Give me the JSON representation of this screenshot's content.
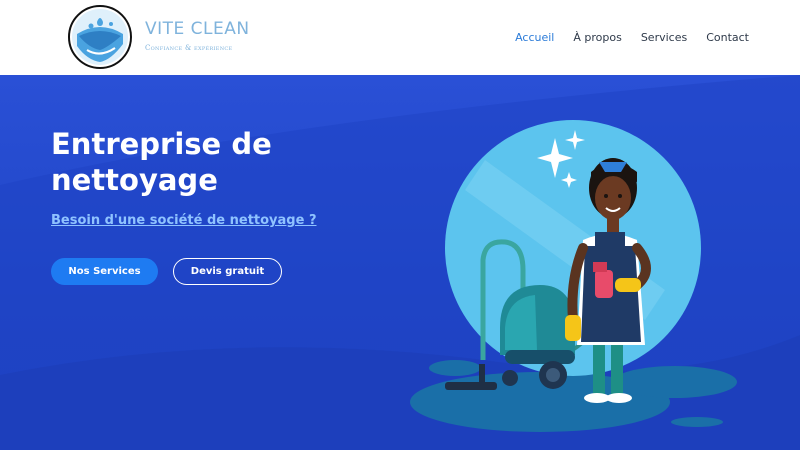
{
  "brand": {
    "name": "VITE CLEAN",
    "tagline": "Confiance & expérience",
    "logo_icon": "water-drop-logo"
  },
  "nav": {
    "items": [
      {
        "label": "Accueil",
        "active": true
      },
      {
        "label": "À propos",
        "active": false
      },
      {
        "label": "Services",
        "active": false
      },
      {
        "label": "Contact",
        "active": false
      }
    ]
  },
  "hero": {
    "title": "Entreprise de nettoyage",
    "link_text": "Besoin d'une société de nettoyage ?",
    "primary_button": "Nos Services",
    "secondary_button": "Devis gratuit",
    "illustration": "cleaning-lady-with-vacuum-illustration"
  },
  "colors": {
    "hero_bg": "#2448cf",
    "nav_active": "#2b7bd8",
    "brand_text": "#7fb3dc",
    "primary_button": "#1e7bf2",
    "link": "#8fc3ff"
  }
}
